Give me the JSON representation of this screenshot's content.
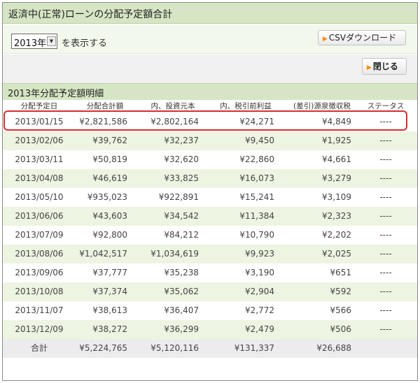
{
  "header": {
    "title": "返済中(正常)ローンの分配予定額合計"
  },
  "filter": {
    "year_value": "2013年",
    "suffix": "を表示する"
  },
  "buttons": {
    "csv": "CSVダウンロード",
    "close": "閉じる"
  },
  "section": {
    "title": "2013年分配予定額明細"
  },
  "table": {
    "columns": [
      "分配予定日",
      "分配合計額",
      "内、投資元本",
      "内、税引前利益",
      "(差引)源泉徴収税",
      "ステータス"
    ],
    "rows": [
      [
        "2013/01/15",
        "¥2,821,586",
        "¥2,802,164",
        "¥24,271",
        "¥4,849",
        "----"
      ],
      [
        "2013/02/06",
        "¥39,762",
        "¥32,237",
        "¥9,450",
        "¥1,925",
        "----"
      ],
      [
        "2013/03/11",
        "¥50,819",
        "¥32,620",
        "¥22,860",
        "¥4,661",
        "----"
      ],
      [
        "2013/04/08",
        "¥46,619",
        "¥33,825",
        "¥16,073",
        "¥3,279",
        "----"
      ],
      [
        "2013/05/10",
        "¥935,023",
        "¥922,891",
        "¥15,241",
        "¥3,109",
        "----"
      ],
      [
        "2013/06/06",
        "¥43,603",
        "¥34,542",
        "¥11,384",
        "¥2,323",
        "----"
      ],
      [
        "2013/07/09",
        "¥92,800",
        "¥84,212",
        "¥10,790",
        "¥2,202",
        "----"
      ],
      [
        "2013/08/06",
        "¥1,042,517",
        "¥1,034,619",
        "¥9,923",
        "¥2,025",
        "----"
      ],
      [
        "2013/09/06",
        "¥37,777",
        "¥35,238",
        "¥3,190",
        "¥651",
        "----"
      ],
      [
        "2013/10/08",
        "¥37,374",
        "¥35,062",
        "¥2,904",
        "¥592",
        "----"
      ],
      [
        "2013/11/07",
        "¥38,613",
        "¥36,407",
        "¥2,772",
        "¥566",
        "----"
      ],
      [
        "2013/12/09",
        "¥38,272",
        "¥36,299",
        "¥2,479",
        "¥506",
        "----"
      ]
    ],
    "total": [
      "合計",
      "¥5,224,765",
      "¥5,120,116",
      "¥131,337",
      "¥26,688",
      ""
    ]
  },
  "colors": {
    "title_green": "#d6e6c4",
    "alt_row": "#edf4e2",
    "highlight_red": "#d72e2e",
    "button_arrow": "#ff8a00"
  },
  "icons": {
    "dropdown": "chevron-down-icon",
    "button_marker": "play-triangle-icon"
  }
}
